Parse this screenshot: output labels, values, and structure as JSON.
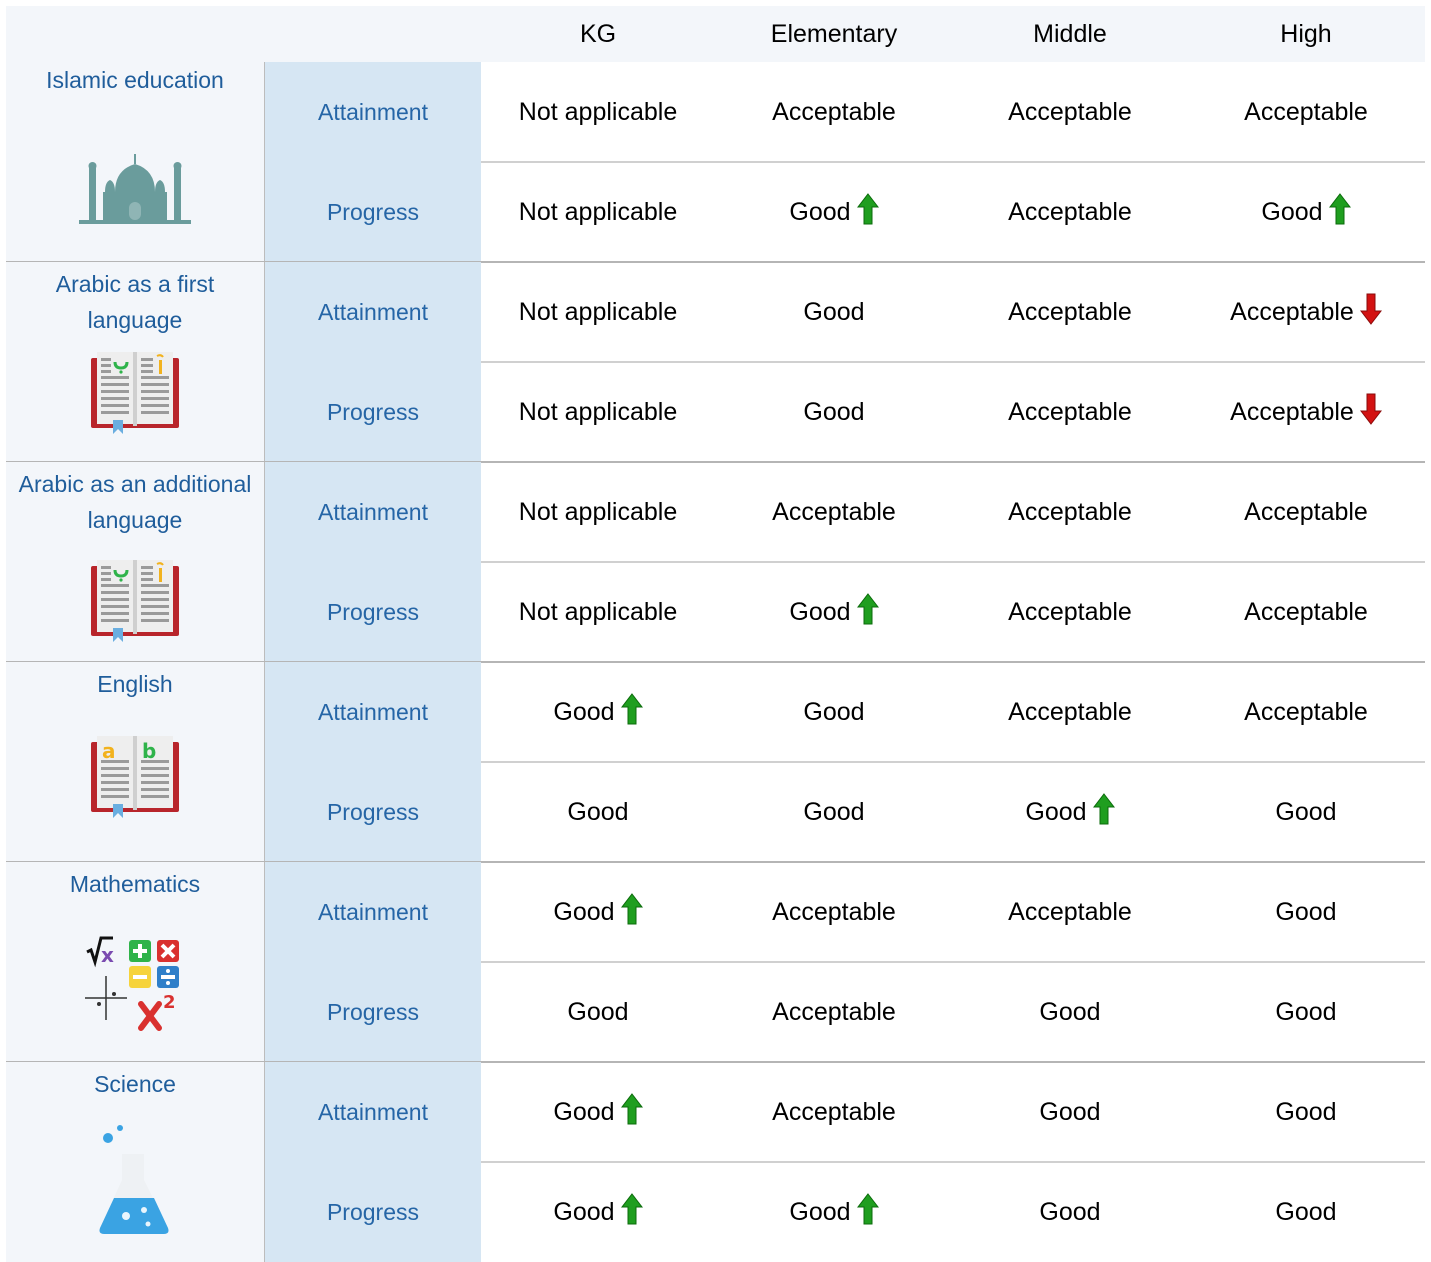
{
  "columns": [
    "KG",
    "Elementary",
    "Middle",
    "High"
  ],
  "colors": {
    "subject_text": "#1f5d9b",
    "metric_text": "#2565a6",
    "up_arrow": "#1f9e1f",
    "down_arrow": "#d31212"
  },
  "subjects": [
    {
      "name": "Islamic education",
      "icon": "mosque-icon",
      "rows": [
        {
          "metric": "Attainment",
          "values": [
            {
              "text": "Not applicable"
            },
            {
              "text": "Acceptable"
            },
            {
              "text": "Acceptable"
            },
            {
              "text": "Acceptable"
            }
          ]
        },
        {
          "metric": "Progress",
          "values": [
            {
              "text": "Not applicable"
            },
            {
              "text": "Good",
              "trend": "up"
            },
            {
              "text": "Acceptable"
            },
            {
              "text": "Good",
              "trend": "up"
            }
          ]
        }
      ]
    },
    {
      "name": "Arabic as a first language",
      "icon": "arabic-book-icon",
      "rows": [
        {
          "metric": "Attainment",
          "values": [
            {
              "text": "Not applicable"
            },
            {
              "text": "Good"
            },
            {
              "text": "Acceptable"
            },
            {
              "text": "Acceptable",
              "trend": "down"
            }
          ]
        },
        {
          "metric": "Progress",
          "values": [
            {
              "text": "Not applicable"
            },
            {
              "text": "Good"
            },
            {
              "text": "Acceptable"
            },
            {
              "text": "Acceptable",
              "trend": "down"
            }
          ]
        }
      ]
    },
    {
      "name": "Arabic as an additional language",
      "icon": "arabic-book-icon",
      "rows": [
        {
          "metric": "Attainment",
          "values": [
            {
              "text": "Not applicable"
            },
            {
              "text": "Acceptable"
            },
            {
              "text": "Acceptable"
            },
            {
              "text": "Acceptable"
            }
          ]
        },
        {
          "metric": "Progress",
          "values": [
            {
              "text": "Not applicable"
            },
            {
              "text": "Good",
              "trend": "up"
            },
            {
              "text": "Acceptable"
            },
            {
              "text": "Acceptable"
            }
          ]
        }
      ]
    },
    {
      "name": "English",
      "icon": "english-book-icon",
      "rows": [
        {
          "metric": "Attainment",
          "values": [
            {
              "text": "Good",
              "trend": "up"
            },
            {
              "text": "Good"
            },
            {
              "text": "Acceptable"
            },
            {
              "text": "Acceptable"
            }
          ]
        },
        {
          "metric": "Progress",
          "values": [
            {
              "text": "Good"
            },
            {
              "text": "Good"
            },
            {
              "text": "Good",
              "trend": "up"
            },
            {
              "text": "Good"
            }
          ]
        }
      ]
    },
    {
      "name": "Mathematics",
      "icon": "math-symbols-icon",
      "rows": [
        {
          "metric": "Attainment",
          "values": [
            {
              "text": "Good",
              "trend": "up"
            },
            {
              "text": "Acceptable"
            },
            {
              "text": "Acceptable"
            },
            {
              "text": "Good"
            }
          ]
        },
        {
          "metric": "Progress",
          "values": [
            {
              "text": "Good"
            },
            {
              "text": "Acceptable"
            },
            {
              "text": "Good"
            },
            {
              "text": "Good"
            }
          ]
        }
      ]
    },
    {
      "name": "Science",
      "icon": "flask-icon",
      "rows": [
        {
          "metric": "Attainment",
          "values": [
            {
              "text": "Good",
              "trend": "up"
            },
            {
              "text": "Acceptable"
            },
            {
              "text": "Good"
            },
            {
              "text": "Good"
            }
          ]
        },
        {
          "metric": "Progress",
          "values": [
            {
              "text": "Good",
              "trend": "up"
            },
            {
              "text": "Good",
              "trend": "up"
            },
            {
              "text": "Good"
            },
            {
              "text": "Good"
            }
          ]
        }
      ]
    }
  ]
}
